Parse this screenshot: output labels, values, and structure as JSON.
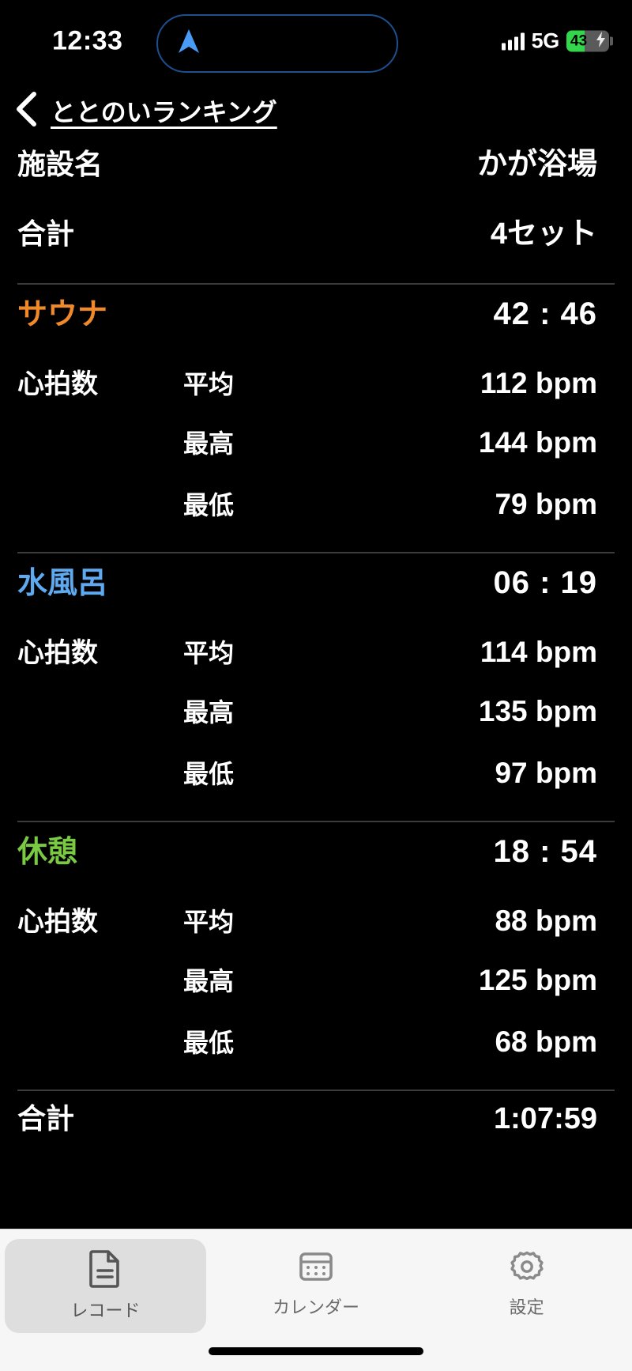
{
  "status_bar": {
    "time": "12:33",
    "network": "5G",
    "battery_percent": "43",
    "battery_level": 43,
    "battery_charging": true,
    "location_active": true,
    "signal_bars": 4,
    "colors": {
      "battery_fill": "#32d74b",
      "location_arrow": "#4a9bf5",
      "island_border": "#1d4f8f"
    }
  },
  "nav": {
    "back_label": "",
    "title": "ととのいランキング"
  },
  "summary": {
    "facility_label": "施設名",
    "facility_value": "かが浴場",
    "sets_label": "合計",
    "sets_value": "4セット"
  },
  "heart_rate_label": "心拍数",
  "sub_labels": {
    "avg": "平均",
    "max": "最高",
    "min": "最低"
  },
  "sections": [
    {
      "name": "サウナ",
      "color": "#f0892a",
      "duration": "42 : 46",
      "hr": {
        "avg": "112 bpm",
        "max": "144 bpm",
        "min": "79 bpm"
      }
    },
    {
      "name": "水風呂",
      "color": "#5ea9f0",
      "duration": "06 : 19",
      "hr": {
        "avg": "114 bpm",
        "max": "135 bpm",
        "min": "97 bpm"
      }
    },
    {
      "name": "休憩",
      "color": "#7ac943",
      "duration": "18 : 54",
      "hr": {
        "avg": "88 bpm",
        "max": "125 bpm",
        "min": "68 bpm"
      }
    }
  ],
  "total": {
    "label": "合計",
    "value": "1:07:59"
  },
  "tabs": [
    {
      "label": "レコード",
      "icon": "document-icon",
      "selected": true
    },
    {
      "label": "カレンダー",
      "icon": "calendar-icon",
      "selected": false
    },
    {
      "label": "設定",
      "icon": "gear-icon",
      "selected": false
    }
  ]
}
